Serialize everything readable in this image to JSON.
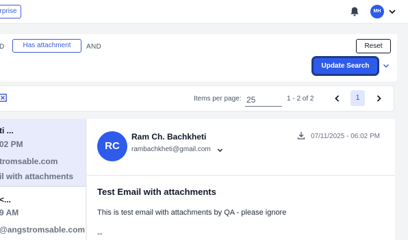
{
  "header": {
    "tag": "erprise",
    "avatar": "MH",
    "icons": {
      "bell": "bell-icon",
      "chevron": "chevron-down-icon"
    }
  },
  "filters": {
    "and_left": "D",
    "chip": "Has attachment",
    "and_right": "AND",
    "reset": "Reset",
    "update": "Update Search"
  },
  "pagination": {
    "items_label": "Items per page:",
    "items_value": "25",
    "range": "1 - 2 of 2",
    "current_page": "1"
  },
  "list": [
    {
      "line1": "ti ...",
      "line2": "02 PM",
      "line3": "tromsable.com",
      "line4": "il with attachments"
    },
    {
      "line1": "<...",
      "line2": "9 AM",
      "line3": "@angstromsable.com"
    }
  ],
  "email": {
    "avatar": "RC",
    "sender": "Ram Ch. Bachkheti",
    "address": "rambachkheti@gmail.com",
    "date": "07/11/2025 - 06:02 PM",
    "subject": "Test Email with attachments",
    "body": "This is test email with attachments by QA - please ignore",
    "signature": "--"
  },
  "colors": {
    "accent": "#2f5bea",
    "selected_row": "#e7ebfb",
    "page_bg": "#f3f4f6"
  }
}
